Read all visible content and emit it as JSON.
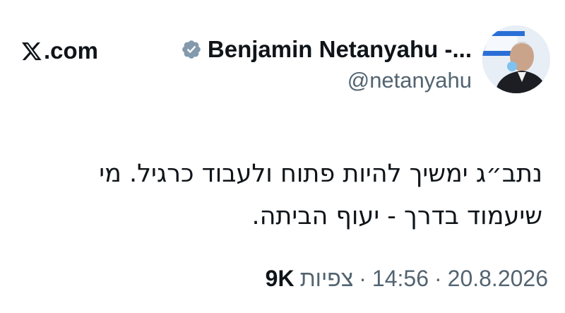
{
  "site": {
    "label": ".com",
    "icon": "x-logo-icon"
  },
  "author": {
    "display_name": "Benjamin Netanyahu -...",
    "handle": "@netanyahu",
    "verified_icon": "verified-badge-icon",
    "verified_color": "#829aab"
  },
  "tweet": {
    "lines": [
      "נתב״ג ימשיך להיות פתוח ולעבוד כרגיל. מי",
      "שיעמוד בדרך - יעוף הביתה."
    ]
  },
  "meta": {
    "date": "20.8.2026",
    "time": "14:56",
    "separator": "·",
    "views_label": "צפיות",
    "views_count": "9K"
  },
  "colors": {
    "text": "#0f1419",
    "secondary": "#536471",
    "background": "#ffffff"
  }
}
